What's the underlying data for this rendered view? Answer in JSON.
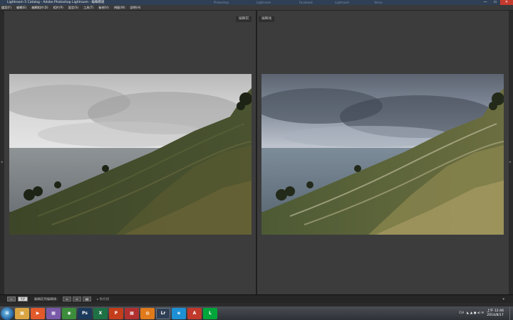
{
  "window": {
    "title": "Lightroom 5 Catalog - Adobe Photoshop Lightroom - 編輯模組",
    "ghost_tabs": [
      "Photoshop",
      "Lightroom",
      "Facebook",
      "Lightroom",
      "Yahoo"
    ],
    "controls": {
      "minimize": "—",
      "maximize": "▭",
      "close": "✕"
    }
  },
  "menu": {
    "items": [
      "檔案(F)",
      "編輯(E)",
      "編輯相片(D)",
      "相片(P)",
      "設定(S)",
      "工具(T)",
      "檢視(V)",
      "視窗(W)",
      "說明(H)"
    ]
  },
  "workspace": {
    "before_label": "編輯前",
    "after_label": "編輯後",
    "left_arrow": "◂",
    "right_arrow": "▸"
  },
  "toolbar": {
    "view_button": "▭",
    "yy_button": "Y|Y",
    "copy_label": "編輯前到編輯後：",
    "btn1": "⇆",
    "btn2": "⇄",
    "btn3": "▮▮",
    "hint": "▸ 軟校樣",
    "chevron": "▾"
  },
  "taskbar": {
    "start": "⊞",
    "apps": [
      {
        "name": "explorer",
        "glyph": "▦",
        "color": "#d9a441"
      },
      {
        "name": "media",
        "glyph": "▶",
        "color": "#e25a2b"
      },
      {
        "name": "grid",
        "glyph": "▦",
        "color": "#7a5aa8"
      },
      {
        "name": "chrome",
        "glyph": "◉",
        "color": "#3c8d3c"
      },
      {
        "name": "photoshop",
        "glyph": "Ps",
        "color": "#1b3a5c"
      },
      {
        "name": "excel",
        "glyph": "X",
        "color": "#1e7145"
      },
      {
        "name": "powerpoint",
        "glyph": "P",
        "color": "#c43e1c"
      },
      {
        "name": "grid-red",
        "glyph": "▦",
        "color": "#b23030"
      },
      {
        "name": "firefox",
        "glyph": "◍",
        "color": "#e07a1a"
      },
      {
        "name": "lightroom",
        "glyph": "Lr",
        "color": "#2f3f55"
      },
      {
        "name": "ie",
        "glyph": "e",
        "color": "#1e90d6"
      },
      {
        "name": "acrobat",
        "glyph": "A",
        "color": "#c0392b"
      },
      {
        "name": "line",
        "glyph": "L",
        "color": "#00a63a"
      }
    ],
    "tray_ime": "CH",
    "tray_glyphs": "◣ ▲ ◼ ◂) ✉",
    "time": "上午 12:46",
    "date": "2014/8/17"
  }
}
